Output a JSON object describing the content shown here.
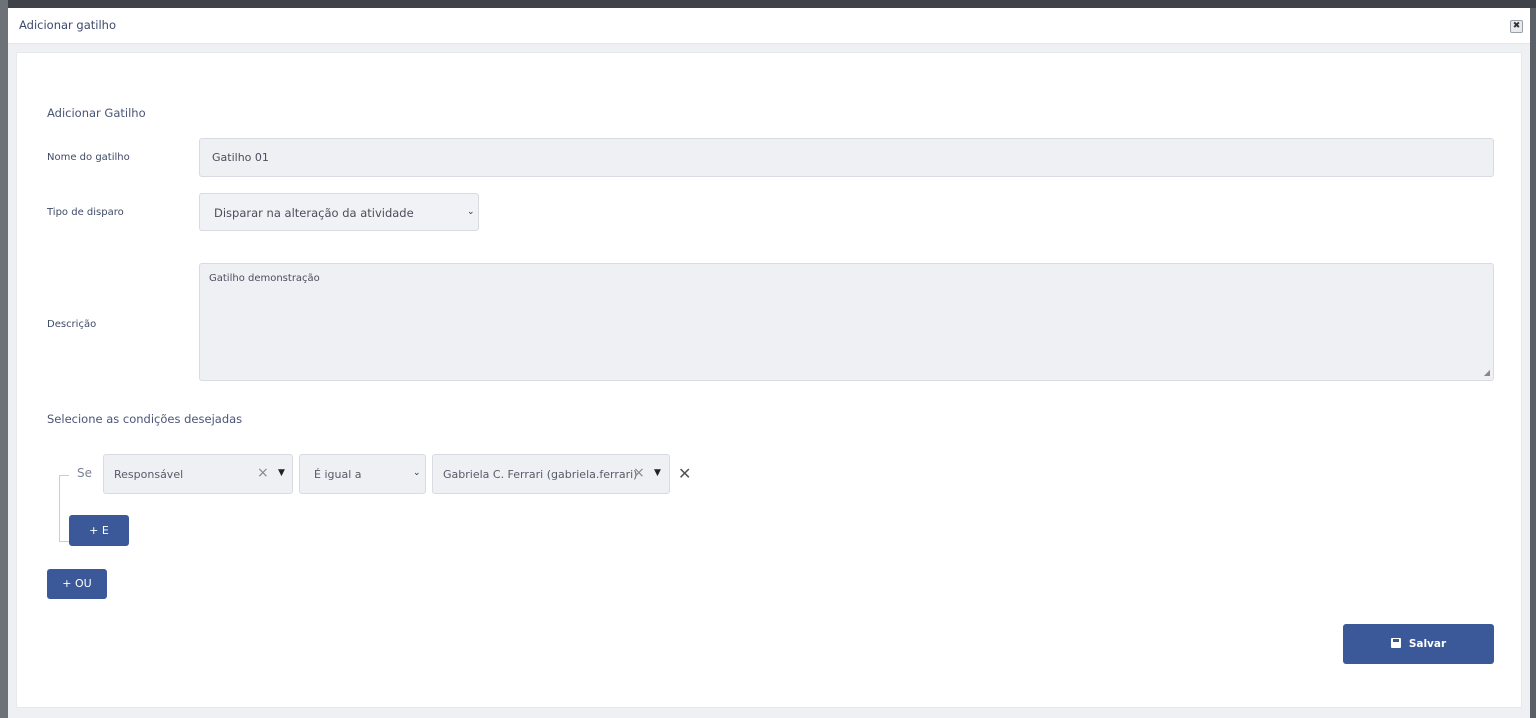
{
  "modal": {
    "title": "Adicionar gatilho",
    "close_icon": "close-icon"
  },
  "form": {
    "section_title": "Adicionar Gatilho",
    "name_label": "Nome do gatilho",
    "name_value": "Gatilho 01",
    "type_label": "Tipo de disparo",
    "type_value": "Disparar na alteração da atividade",
    "description_label": "Descrição",
    "description_value": "Gatilho demonstração"
  },
  "conditions": {
    "title": "Selecione as condições desejadas",
    "if_label": "Se",
    "rows": [
      {
        "field": "Responsável",
        "operator": "É igual a",
        "value": "Gabriela C. Ferrari (gabriela.ferrari)"
      }
    ],
    "and_button": "+ E",
    "or_button": "+ OU"
  },
  "actions": {
    "save_label": "Salvar",
    "save_icon": "floppy-disk-icon"
  },
  "colors": {
    "primary": "#3b5998",
    "input_bg": "#eff0f4",
    "text": "#3f4a66"
  }
}
